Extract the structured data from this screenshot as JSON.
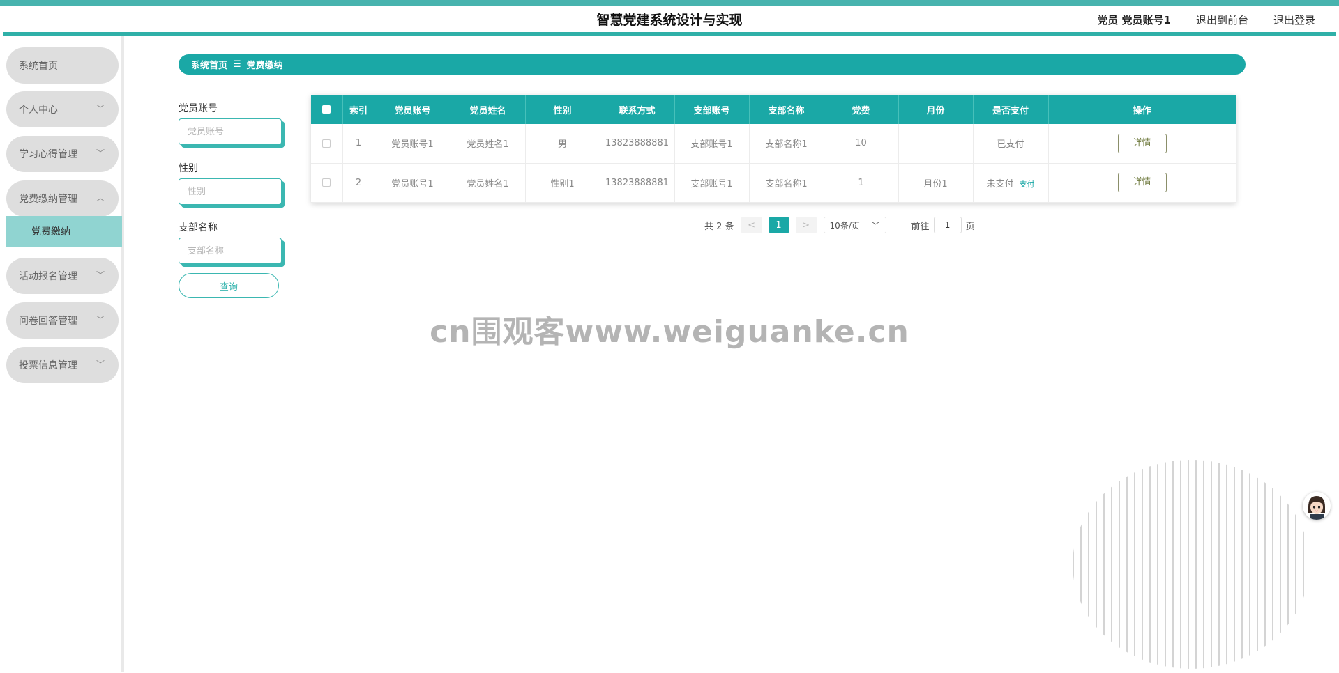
{
  "header": {
    "title": "智慧党建系统设计与实现",
    "user_label": "党员 党员账号1",
    "link_front": "退出到前台",
    "link_logout": "退出登录"
  },
  "sidebar": {
    "items": [
      {
        "label": "系统首页"
      },
      {
        "label": "个人中心"
      },
      {
        "label": "学习心得管理"
      },
      {
        "label": "党费缴纳管理"
      },
      {
        "label": "活动报名管理"
      },
      {
        "label": "问卷回答管理"
      },
      {
        "label": "投票信息管理"
      }
    ],
    "subitem": "党费缴纳"
  },
  "breadcrumb": {
    "home": "系统首页",
    "sep": "☰",
    "current": "党费缴纳"
  },
  "filters": {
    "account_label": "党员账号",
    "account_placeholder": "党员账号",
    "gender_label": "性别",
    "gender_placeholder": "性别",
    "branch_label": "支部名称",
    "branch_placeholder": "支部名称",
    "query_button": "查询"
  },
  "table": {
    "columns": [
      "索引",
      "党员账号",
      "党员姓名",
      "性别",
      "联系方式",
      "支部账号",
      "支部名称",
      "党费",
      "月份",
      "是否支付",
      "操作"
    ],
    "rows": [
      {
        "index": "1",
        "account": "党员账号1",
        "name": "党员姓名1",
        "gender": "男",
        "phone": "13823888881",
        "branch_account": "支部账号1",
        "branch_name": "支部名称1",
        "fee": "10",
        "month": "",
        "paid": "已支付",
        "pay_link": "",
        "action": "详情"
      },
      {
        "index": "2",
        "account": "党员账号1",
        "name": "党员姓名1",
        "gender": "性别1",
        "phone": "13823888881",
        "branch_account": "支部账号1",
        "branch_name": "支部名称1",
        "fee": "1",
        "month": "月份1",
        "paid": "未支付",
        "pay_link": "支付",
        "action": "详情"
      }
    ]
  },
  "pagination": {
    "total": "共 2 条",
    "prev": "<",
    "current_page": "1",
    "next": ">",
    "page_size": "10条/页",
    "goto_label": "前往",
    "goto_value": "1",
    "page_suffix": "页"
  },
  "watermark": "cn围观客www.weiguanke.cn",
  "colors": {
    "primary": "#1aa8a6",
    "sidebar_sub": "#90d4d1",
    "menu_bg": "#dedede"
  }
}
